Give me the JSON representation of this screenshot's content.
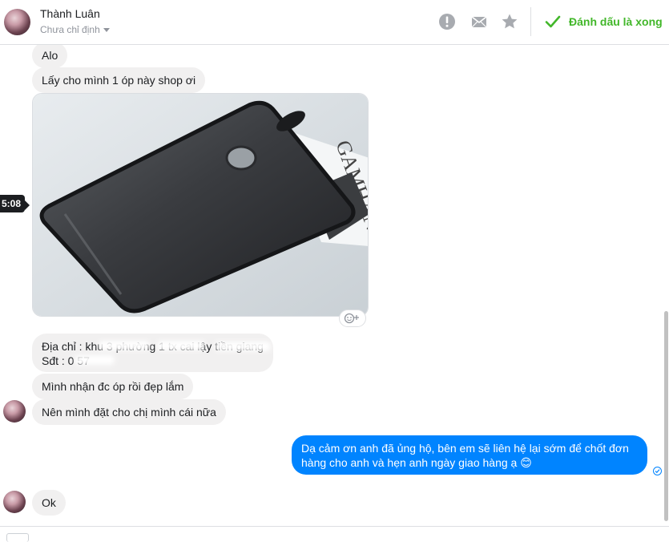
{
  "header": {
    "contact_name": "Thành Luân",
    "assign_label": "Chưa chỉ định",
    "mark_done_label": "Đánh dấu là xong"
  },
  "icons": {
    "report": "exclamation-circle-icon",
    "mail": "envelope-icon",
    "star": "star-icon",
    "done": "checkmark-icon",
    "react": "emoji-add-icon",
    "seen": "seen-check-icon"
  },
  "colors": {
    "outgoing_bubble": "#0084ff",
    "incoming_bubble": "#f1f0f0",
    "done_green": "#42b72a"
  },
  "messages": {
    "m1": "Alo",
    "m2": "Lấy cho mình 1 óp này shop ơi",
    "timestamp": "5:08",
    "m3_line1": "Địa chỉ : khu 3 phường 1 tx cai lậy tiền giang",
    "m3_line2": "Sđt : 0          57",
    "m4": "Mình nhận đc óp rồi đẹp lắm",
    "m5": "Nên mình đặt cho chị mình cái nữa",
    "m6": "Dạ cảm ơn anh đã ủng hộ, bên em sẽ liên hệ lại sớm để chốt đơn hàng cho anh và hẹn anh ngày giao hàng ạ 😊",
    "m7": "Ok"
  },
  "image_message": {
    "box_text": "GAMHAN"
  }
}
